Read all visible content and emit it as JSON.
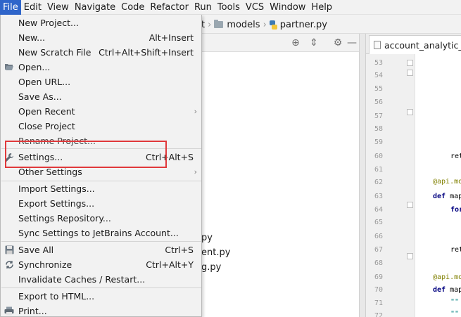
{
  "menubar": {
    "items": [
      "File",
      "Edit",
      "View",
      "Navigate",
      "Code",
      "Refactor",
      "Run",
      "Tools",
      "VCS",
      "Window",
      "Help"
    ]
  },
  "breadcrumb": {
    "partial": "t",
    "folder": "models",
    "file": "partner.py"
  },
  "project_tree": {
    "files": [
      "py",
      "ent.py",
      "g.py"
    ]
  },
  "editor": {
    "tab_label": "account_analytic_lin",
    "line_numbers": [
      "53",
      "54",
      "55",
      "56",
      "57",
      "58",
      "59",
      "60",
      "61",
      "62",
      "63",
      "64",
      "65",
      "66",
      "67",
      "68",
      "69",
      "70",
      "71",
      "72"
    ],
    "code_lines": {
      "l60": "ret",
      "l62": "@api.mo",
      "l63_kw": "def",
      "l63": " map",
      "l64_kw": "for",
      "l67": "ret",
      "l69": "@api.mo",
      "l70_kw": "def",
      "l70": " map",
      "l71": "\"\"",
      "l72": "\"\""
    }
  },
  "file_menu": {
    "items": [
      {
        "label": "New Project...",
        "shortcut": ""
      },
      {
        "label": "New...",
        "shortcut": "Alt+Insert"
      },
      {
        "label": "New Scratch File",
        "shortcut": "Ctrl+Alt+Shift+Insert"
      },
      {
        "label": "Open...",
        "shortcut": "",
        "icon": "folder-open-icon"
      },
      {
        "label": "Open URL...",
        "shortcut": ""
      },
      {
        "label": "Save As...",
        "shortcut": ""
      },
      {
        "label": "Open Recent",
        "shortcut": "",
        "submenu": true
      },
      {
        "label": "Close Project",
        "shortcut": ""
      },
      {
        "label": "Rename Project...",
        "shortcut": ""
      },
      {
        "label": "Settings...",
        "shortcut": "Ctrl+Alt+S",
        "icon": "wrench-icon"
      },
      {
        "label": "Other Settings",
        "shortcut": "",
        "submenu": true
      },
      {
        "label": "Import Settings...",
        "shortcut": ""
      },
      {
        "label": "Export Settings...",
        "shortcut": ""
      },
      {
        "label": "Settings Repository...",
        "shortcut": ""
      },
      {
        "label": "Sync Settings to JetBrains Account...",
        "shortcut": ""
      },
      {
        "label": "Save All",
        "shortcut": "Ctrl+S",
        "icon": "save-icon"
      },
      {
        "label": "Synchronize",
        "shortcut": "Ctrl+Alt+Y",
        "icon": "sync-icon"
      },
      {
        "label": "Invalidate Caches / Restart...",
        "shortcut": ""
      },
      {
        "label": "Export to HTML...",
        "shortcut": ""
      },
      {
        "label": "Print...",
        "shortcut": "",
        "icon": "print-icon"
      }
    ]
  },
  "colors": {
    "menu_active": "#2f65ca",
    "highlight_box": "#e0393b",
    "keyword": "#000080",
    "decorator": "#808000"
  }
}
